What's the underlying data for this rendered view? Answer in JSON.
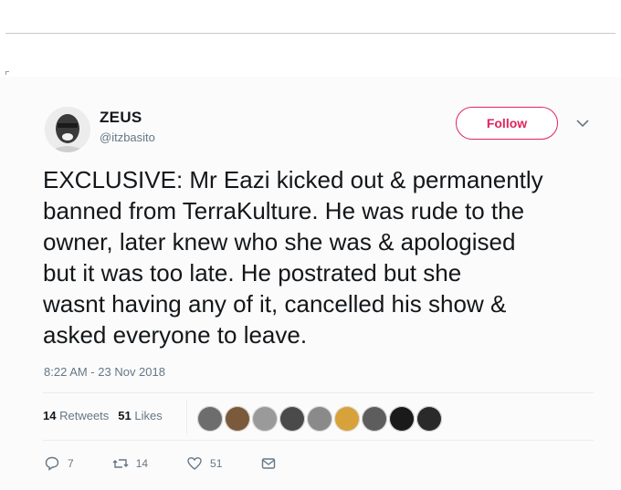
{
  "tweet": {
    "author": {
      "name": "ZEUS",
      "handle": "@itzbasito"
    },
    "follow_label": "Follow",
    "text": "EXCLUSIVE: Mr Eazi kicked out & permanently\nbanned from TerraKulture. He was rude to the\nowner, later knew who she was & apologised\nbut it was too late. He postrated but she\nwasnt having any of it, cancelled his show &\nasked everyone to leave.",
    "timestamp": "8:22 AM - 23 Nov 2018",
    "stats": {
      "retweets_count": "14",
      "retweets_label": "Retweets",
      "likes_count": "51",
      "likes_label": "Likes"
    },
    "likers_colors": [
      "#6d6d6d",
      "#7a5a3a",
      "#9a9a9a",
      "#4a4a4a",
      "#8a8a8a",
      "#d8a23a",
      "#5d5d5d",
      "#1a1a1a",
      "#2a2a2a"
    ],
    "actions": {
      "reply_count": "7",
      "retweet_count": "14",
      "like_count": "51"
    },
    "colors": {
      "follow": "#e0245e",
      "muted": "#657786",
      "text": "#14171a"
    }
  }
}
